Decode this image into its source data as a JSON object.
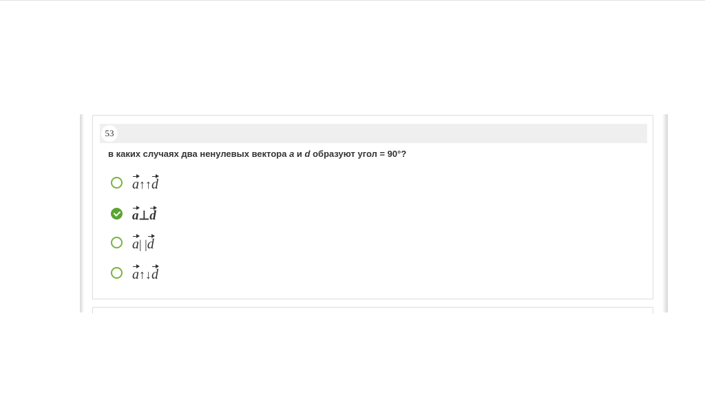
{
  "question": {
    "number": "53",
    "text_before": "в каких случаях два ненулевых вектора ",
    "var_a": "a",
    "text_and": " и ",
    "var_d": "d",
    "text_after": " образуют угол = 90°?"
  },
  "options": [
    {
      "a": "a",
      "op": "↑↑",
      "d": "d",
      "selected": false
    },
    {
      "a": "a",
      "op": "⊥",
      "d": "d",
      "selected": true
    },
    {
      "a": "a",
      "op": "| |",
      "d": "d",
      "selected": false
    },
    {
      "a": "a",
      "op": "↑↓",
      "d": "d",
      "selected": false
    }
  ],
  "colors": {
    "accent": "#79b33c",
    "checked": "#5aa52f"
  }
}
